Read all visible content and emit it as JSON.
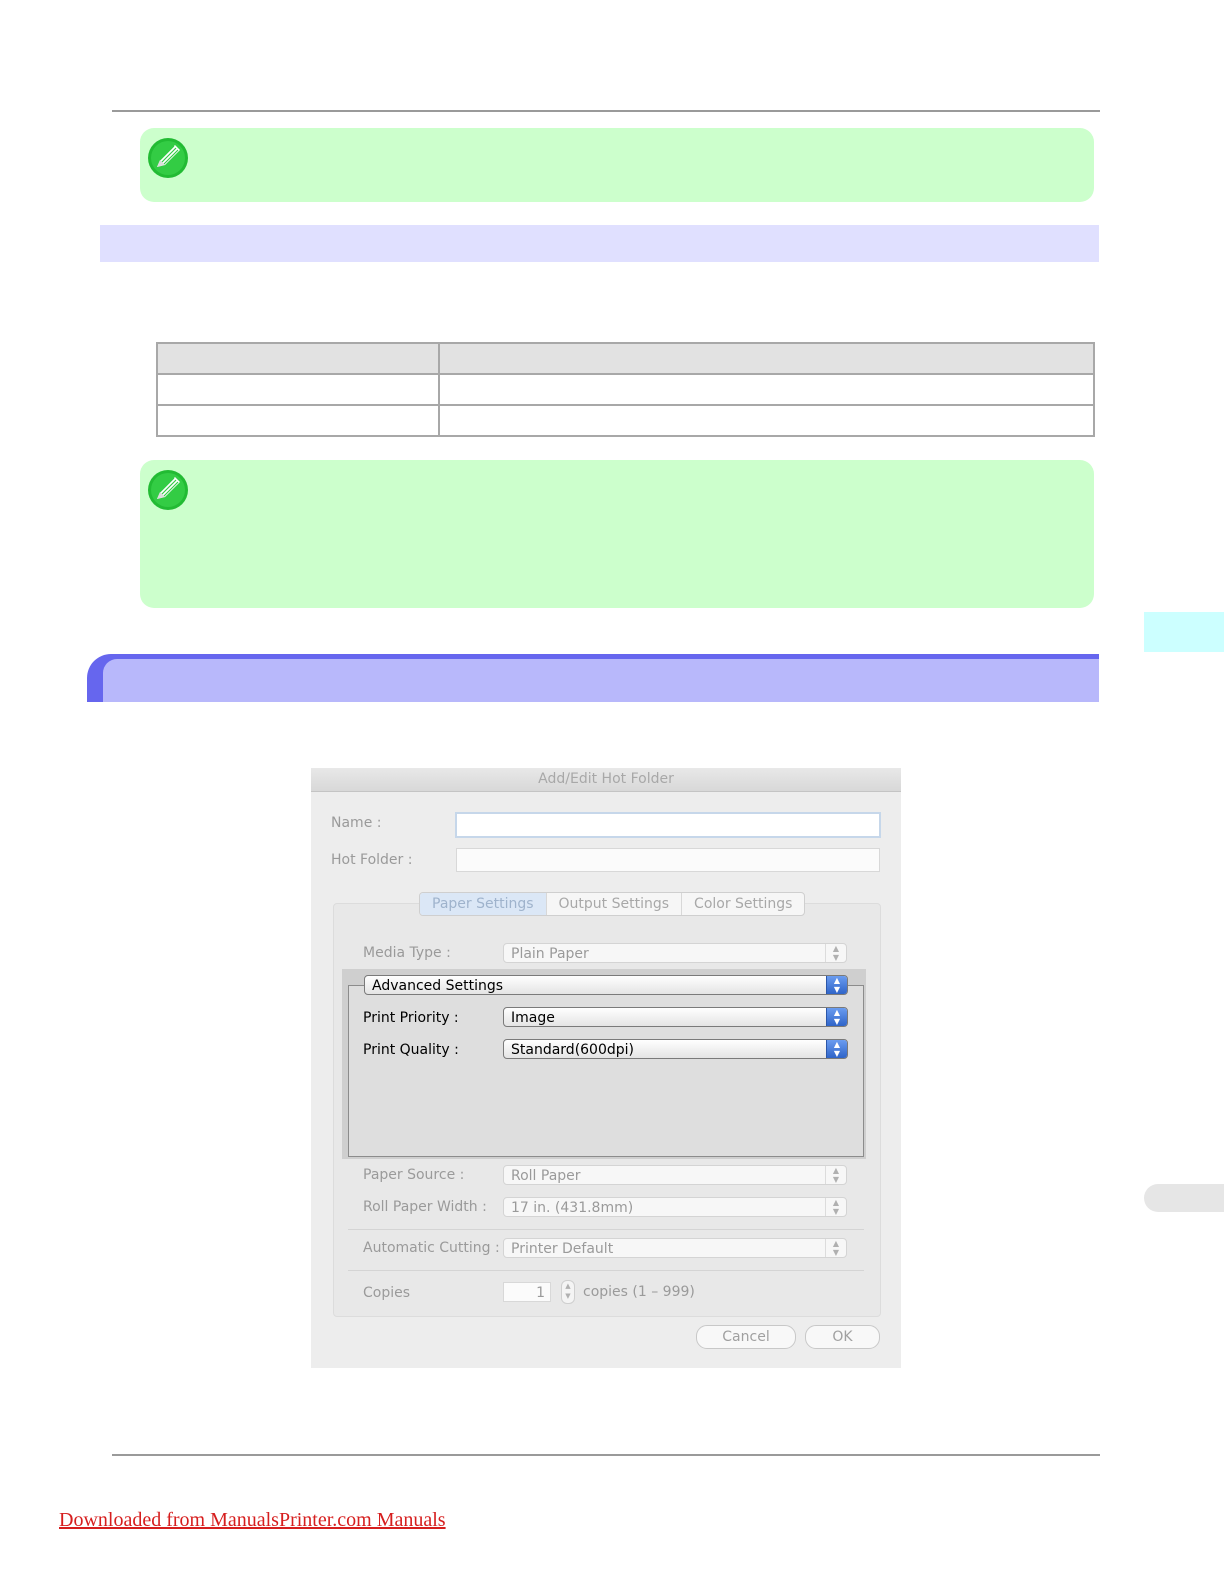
{
  "dialog": {
    "title": "Add/Edit Hot Folder",
    "name_label": "Name :",
    "name_value": "",
    "hot_folder_label": "Hot Folder :",
    "hot_folder_value": "",
    "tabs": [
      {
        "label": "Paper Settings",
        "active": true
      },
      {
        "label": "Output Settings",
        "active": false
      },
      {
        "label": "Color Settings",
        "active": false
      }
    ],
    "media_type": {
      "label": "Media Type :",
      "value": "Plain Paper"
    },
    "advanced": {
      "value": "Advanced Settings"
    },
    "print_priority": {
      "label": "Print Priority :",
      "value": "Image"
    },
    "print_quality": {
      "label": "Print Quality :",
      "value": "Standard(600dpi)"
    },
    "paper_source": {
      "label": "Paper Source :",
      "value": "Roll Paper"
    },
    "roll_paper_width": {
      "label": "Roll Paper Width :",
      "value": "17 in. (431.8mm)"
    },
    "automatic_cutting": {
      "label": "Automatic Cutting :",
      "value": "Printer Default"
    },
    "copies": {
      "label": "Copies",
      "value": "1",
      "range": "copies (1 – 999)"
    },
    "cancel_label": "Cancel",
    "ok_label": "OK"
  },
  "footer": {
    "link_text": "Downloaded from ManualsPrinter.com Manuals"
  },
  "colors": {
    "note_bg": "#ccffcc",
    "subhead_bg": "#e0e0ff",
    "section_band": "#6666ee",
    "section_band_inner": "#b8b8fb",
    "link": "#d61e1e"
  }
}
